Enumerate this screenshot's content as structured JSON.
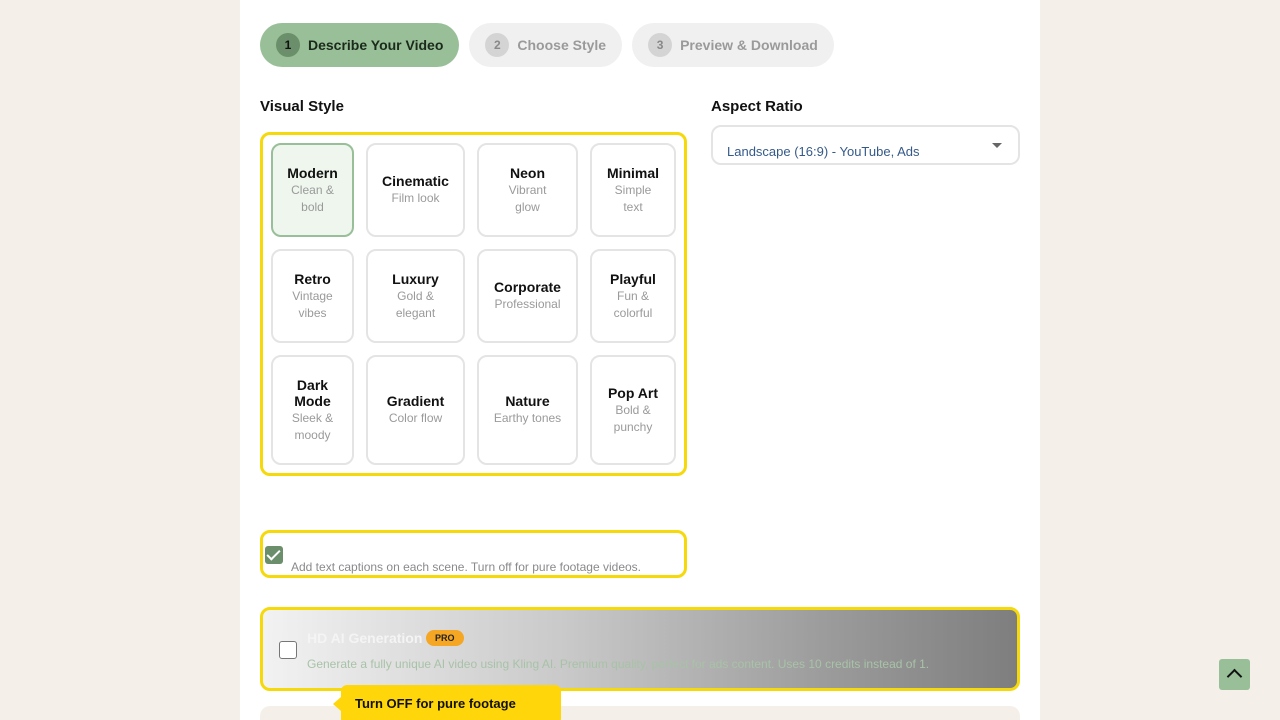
{
  "steps": [
    {
      "num": "1",
      "label": "Describe Your Video",
      "active": true
    },
    {
      "num": "2",
      "label": "Choose Style",
      "active": false
    },
    {
      "num": "3",
      "label": "Preview & Download",
      "active": false
    }
  ],
  "visual_style": {
    "label": "Visual Style",
    "selected": "Modern",
    "options": [
      {
        "title": "Modern",
        "subtitle": "Clean & bold"
      },
      {
        "title": "Cinematic",
        "subtitle": "Film look"
      },
      {
        "title": "Neon",
        "subtitle": "Vibrant glow"
      },
      {
        "title": "Minimal",
        "subtitle": "Simple text"
      },
      {
        "title": "Retro",
        "subtitle": "Vintage vibes"
      },
      {
        "title": "Luxury",
        "subtitle": "Gold & elegant"
      },
      {
        "title": "Corporate",
        "subtitle": "Professional"
      },
      {
        "title": "Playful",
        "subtitle": "Fun & colorful"
      },
      {
        "title": "Dark Mode",
        "subtitle": "Sleek & moody"
      },
      {
        "title": "Gradient",
        "subtitle": "Color flow"
      },
      {
        "title": "Nature",
        "subtitle": "Earthy tones"
      },
      {
        "title": "Pop Art",
        "subtitle": "Bold & punchy"
      }
    ]
  },
  "aspect_ratio": {
    "label": "Aspect Ratio",
    "value": "Landscape (16:9) - YouTube, Ads"
  },
  "captions": {
    "checked": true,
    "description": "Add text captions on each scene. Turn off for pure footage videos."
  },
  "hd_generation": {
    "checked": false,
    "title": "HD AI Generation",
    "badge": "PRO",
    "description": "Generate a fully unique AI video using Kling AI. Premium quality, perfect for ads content. Uses 10 credits instead of 1."
  },
  "tooltip": {
    "text": "Turn OFF for pure footage"
  },
  "colors": {
    "accent_green": "#98bf98",
    "highlight_yellow": "#f5d90a",
    "pro_badge": "#f5a623",
    "background": "#f4f0e9"
  },
  "icons": {
    "scroll_top": "chevron-up-icon"
  }
}
